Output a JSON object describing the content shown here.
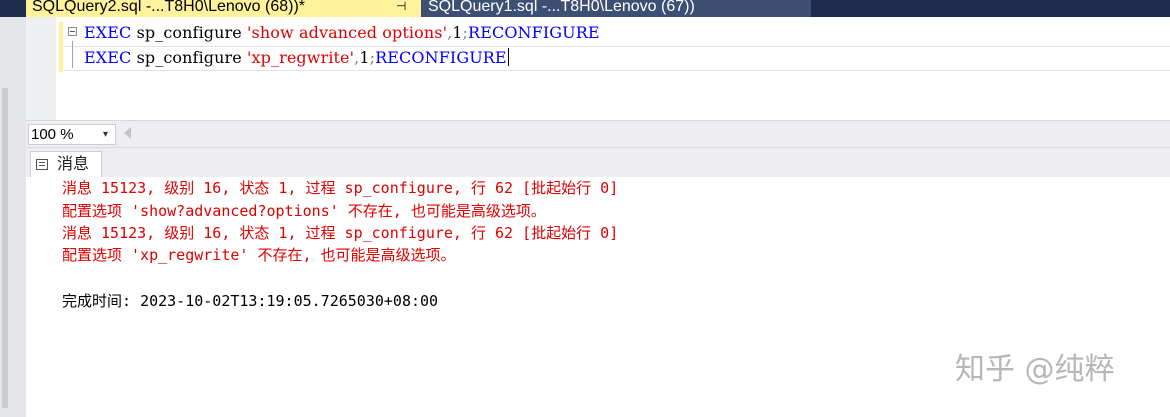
{
  "tabs": [
    {
      "label": "SQLQuery2.sql -...T8H0\\Lenovo (68))*",
      "active": true
    },
    {
      "label": "SQLQuery1.sql -...T8H0\\Lenovo (67))",
      "active": false
    }
  ],
  "tab_pin_glyph": "⊣",
  "tab_close_glyph": "✕",
  "editor": {
    "line1": {
      "kw1": "EXEC",
      "proc": " sp_configure ",
      "str": "'show advanced options'",
      "sep": ",",
      "num": "1",
      "semi": ";",
      "kw2": "RECONFIGURE"
    },
    "line2": {
      "kw1": "EXEC",
      "proc": " sp_configure ",
      "str": "'xp_regwrite'",
      "sep": ",",
      "num": "1",
      "semi": ";",
      "kw2": "RECONFIGURE"
    }
  },
  "zoom": {
    "value": "100 %",
    "arrow": "▾"
  },
  "messages_tab": {
    "label": "消息"
  },
  "messages": [
    "消息 15123, 级别 16, 状态 1, 过程 sp_configure, 行 62 [批起始行 0]",
    "配置选项 'show?advanced?options' 不存在, 也可能是高级选项。",
    "消息 15123, 级别 16, 状态 1, 过程 sp_configure, 行 62 [批起始行 0]",
    "配置选项 'xp_regwrite' 不存在, 也可能是高级选项。"
  ],
  "completion": {
    "label": "完成时间: ",
    "time": "2023-10-02T13:19:05.7265030+08:00"
  },
  "watermark": "知乎 @纯粹",
  "colors": {
    "keyword": "#0000ff",
    "string": "#e00000",
    "error_text": "#e00000",
    "tab_active": "#fff29d",
    "tab_bar": "#1e2d4d"
  }
}
